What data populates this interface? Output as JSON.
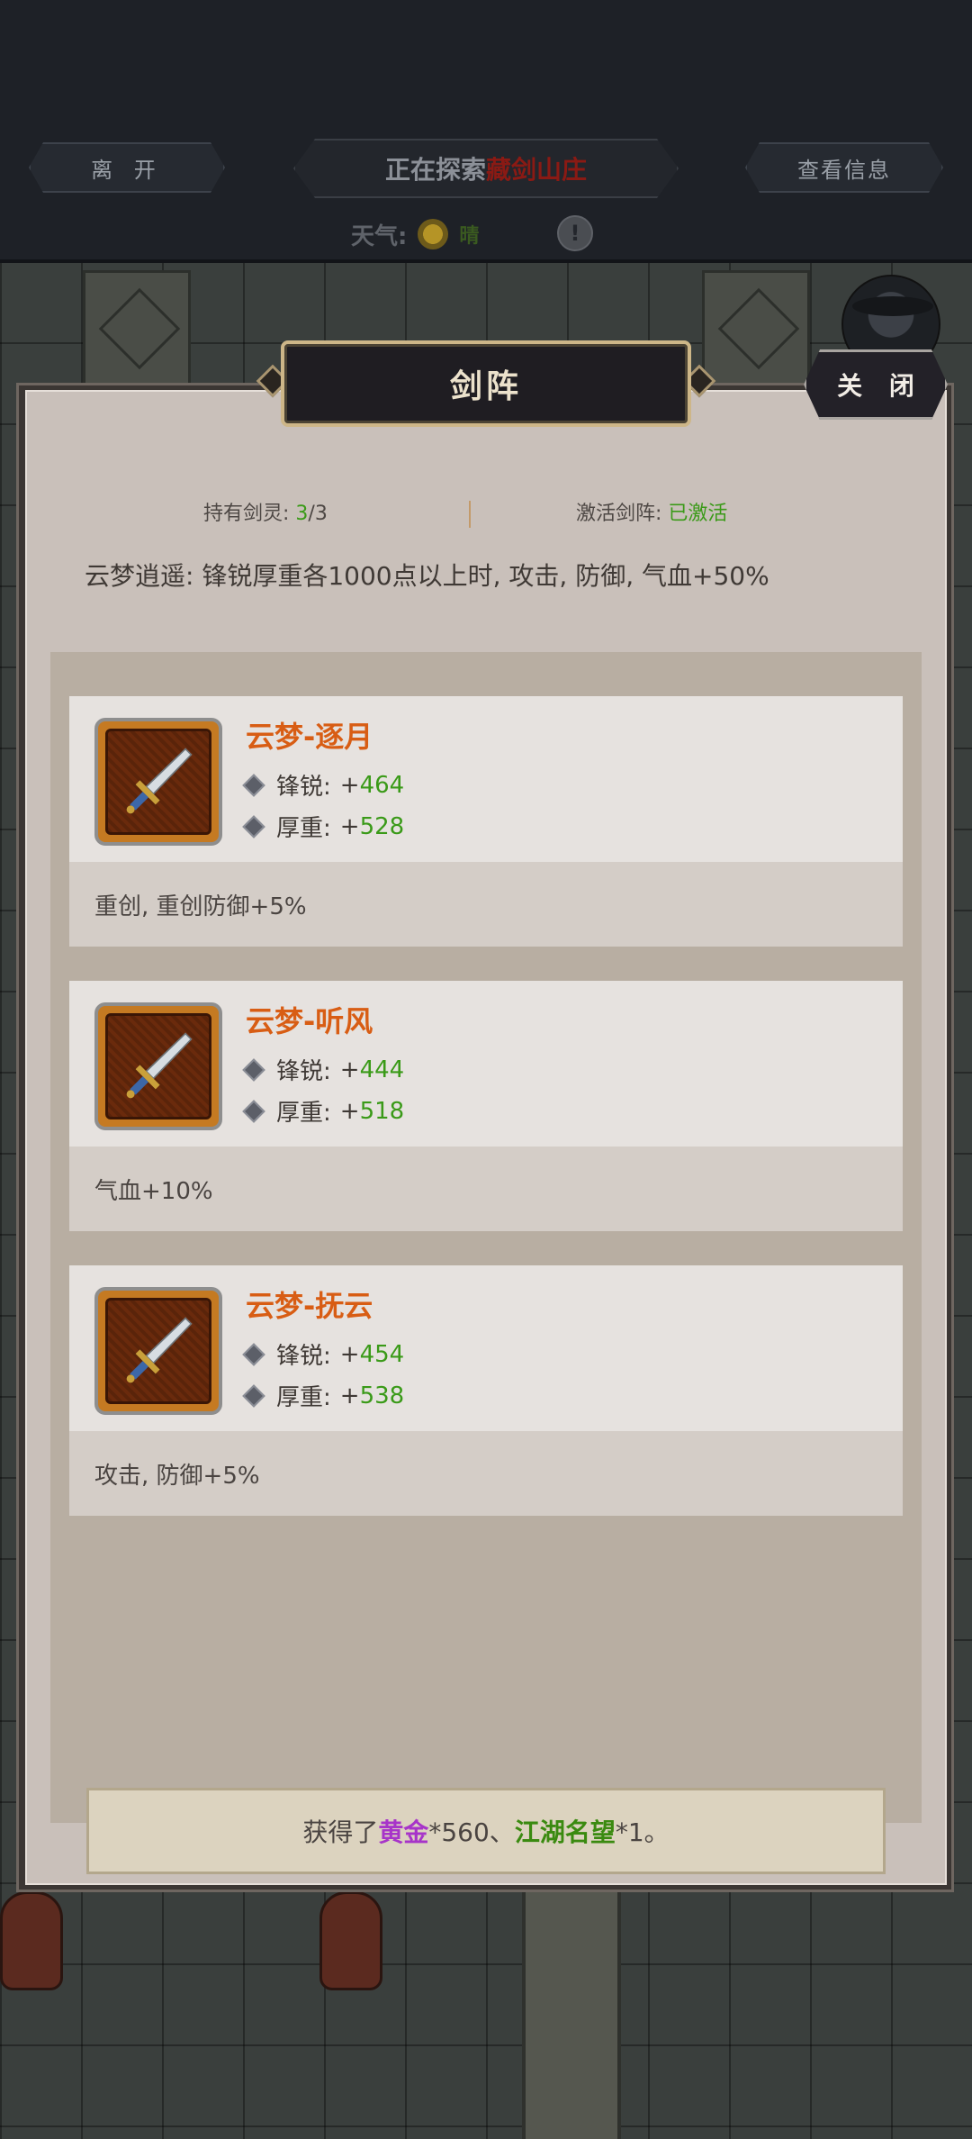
{
  "topbar": {
    "leave_label": "离 开",
    "explore_prefix": "正在探索",
    "explore_place": "藏剑山庄",
    "info_label": "查看信息",
    "weather_label": "天气:",
    "weather_state": "晴",
    "alert_glyph": "!"
  },
  "dialog": {
    "title": "剑阵",
    "close_label": "关 闭",
    "held_label": "持有剑灵:",
    "held_current": "3",
    "held_total": "/3",
    "active_label": "激活剑阵:",
    "active_value": "已激活",
    "set_effect": "云梦逍遥: 锋锐厚重各1000点以上时, 攻击, 防御, 气血+50%"
  },
  "cards": [
    {
      "name": "云梦-逐月",
      "stat1_label": "锋锐:",
      "stat1_plus": "+",
      "stat1_value": "464",
      "stat2_label": "厚重:",
      "stat2_plus": "+",
      "stat2_value": "528",
      "effect": "重创, 重创防御+5%"
    },
    {
      "name": "云梦-听风",
      "stat1_label": "锋锐:",
      "stat1_plus": "+",
      "stat1_value": "444",
      "stat2_label": "厚重:",
      "stat2_plus": "+",
      "stat2_value": "518",
      "effect": "气血+10%"
    },
    {
      "name": "云梦-抚云",
      "stat1_label": "锋锐:",
      "stat1_plus": "+",
      "stat1_value": "454",
      "stat2_label": "厚重:",
      "stat2_plus": "+",
      "stat2_value": "538",
      "effect": "攻击, 防御+5%"
    }
  ],
  "reward": {
    "prefix": "获得了",
    "gold": "黄金",
    "gold_qty": "*560、",
    "fame": "江湖名望",
    "fame_qty": "*1。"
  },
  "colors": {
    "card_name": "#d85d14",
    "stat_value": "#3a9a18",
    "gold": "#a734c9",
    "fame": "#3a8a10",
    "place": "#8a1a14"
  },
  "icons": {
    "weapon": "sword-icon",
    "stat_bullet": "diamond-icon",
    "weather": "sun-icon"
  }
}
